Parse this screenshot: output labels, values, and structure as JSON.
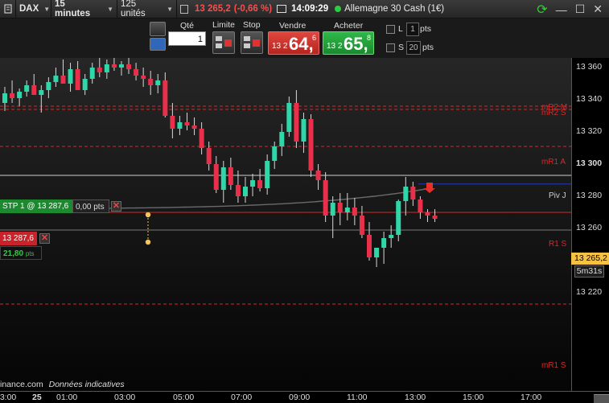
{
  "topbar": {
    "instrument": "DAX",
    "timeframe": "15 minutes",
    "units": "125 unités",
    "last_price": "13 265,2",
    "change": "(-0,66 %)",
    "time": "14:09:29",
    "product": "Allemagne 30 Cash (1€)"
  },
  "orderbar": {
    "qty_label": "Qté",
    "qty_value": "1",
    "limit_label": "Limite",
    "stop_label": "Stop",
    "sell_label": "Vendre",
    "buy_label": "Acheter",
    "sell_price_small": "13 2",
    "sell_price_big": "64,",
    "sell_price_frac": "6",
    "buy_price_small": "13 2",
    "buy_price_big": "65,",
    "buy_price_frac": "8",
    "l_label": "L",
    "l_value": "1",
    "l_unit": "pts",
    "s_label": "S",
    "s_value": "20",
    "s_unit": "pts"
  },
  "chart": {
    "stp_order_label": "STP  1 @ 13 287,6",
    "stp_order_pts": "0,00 pts",
    "position_price": "13 287,6",
    "position_pnl": "21,80",
    "position_pnl_unit": "pts",
    "level_labels": {
      "mR2M": "mR2 M",
      "mR2S": "mR2 S",
      "mR1A": "mR1 A",
      "pivot": "Piv J",
      "R1S": "R1 S",
      "mR1S": "mR1 S"
    },
    "current_price_tag": "13 265,2",
    "countdown": "5m31s",
    "footer_source": "inance.com",
    "footer_note": "Données indicatives",
    "colors": {
      "up": "#2fd6a7",
      "down": "#e8304a",
      "red_level": "#d42a2a",
      "pivot": "#cfcfcf",
      "blue_line": "#1f3bb3"
    }
  },
  "y_axis": [
    "13 360",
    "13 340",
    "13 320",
    "13 300",
    "13 280",
    "13 260",
    "13 240",
    "13 220"
  ],
  "x_axis": [
    "23:00",
    "25",
    "01:00",
    "03:00",
    "05:00",
    "07:00",
    "09:00",
    "11:00",
    "13:00",
    "15:00",
    "17:00"
  ],
  "candles": [
    [
      13338,
      13348,
      13333,
      13344
    ],
    [
      13344,
      13352,
      13338,
      13341
    ],
    [
      13341,
      13347,
      13336,
      13345
    ],
    [
      13345,
      13352,
      13342,
      13349
    ],
    [
      13349,
      13356,
      13345,
      13343
    ],
    [
      13343,
      13349,
      13332,
      13346
    ],
    [
      13346,
      13354,
      13341,
      13351
    ],
    [
      13351,
      13360,
      13348,
      13355
    ],
    [
      13355,
      13365,
      13352,
      13350
    ],
    [
      13350,
      13363,
      13345,
      13359
    ],
    [
      13359,
      13364,
      13348,
      13346
    ],
    [
      13346,
      13356,
      13343,
      13353
    ],
    [
      13353,
      13363,
      13350,
      13360
    ],
    [
      13360,
      13366,
      13354,
      13357
    ],
    [
      13357,
      13365,
      13353,
      13362
    ],
    [
      13362,
      13366,
      13358,
      13360
    ],
    [
      13360,
      13364,
      13355,
      13362
    ],
    [
      13362,
      13366,
      13356,
      13359
    ],
    [
      13359,
      13363,
      13352,
      13355
    ],
    [
      13355,
      13360,
      13348,
      13353
    ],
    [
      13353,
      13358,
      13343,
      13349
    ],
    [
      13349,
      13356,
      13344,
      13352
    ],
    [
      13352,
      13357,
      13329,
      13330
    ],
    [
      13330,
      13338,
      13316,
      13322
    ],
    [
      13322,
      13330,
      13318,
      13326
    ],
    [
      13326,
      13332,
      13321,
      13324
    ],
    [
      13324,
      13329,
      13318,
      13322
    ],
    [
      13322,
      13326,
      13306,
      13310
    ],
    [
      13310,
      13314,
      13296,
      13300
    ],
    [
      13300,
      13305,
      13282,
      13284
    ],
    [
      13284,
      13302,
      13276,
      13298
    ],
    [
      13298,
      13304,
      13284,
      13287
    ],
    [
      13287,
      13296,
      13276,
      13280
    ],
    [
      13280,
      13292,
      13276,
      13286
    ],
    [
      13286,
      13294,
      13280,
      13290
    ],
    [
      13290,
      13297,
      13283,
      13285
    ],
    [
      13285,
      13306,
      13281,
      13302
    ],
    [
      13302,
      13314,
      13297,
      13311
    ],
    [
      13311,
      13325,
      13305,
      13320
    ],
    [
      13320,
      13342,
      13317,
      13338
    ],
    [
      13338,
      13346,
      13310,
      13314
    ],
    [
      13314,
      13332,
      13307,
      13328
    ],
    [
      13328,
      13331,
      13292,
      13296
    ],
    [
      13296,
      13300,
      13284,
      13290
    ],
    [
      13290,
      13295,
      13264,
      13268
    ],
    [
      13268,
      13280,
      13254,
      13276
    ],
    [
      13276,
      13282,
      13262,
      13270
    ],
    [
      13270,
      13282,
      13265,
      13273
    ],
    [
      13273,
      13279,
      13262,
      13268
    ],
    [
      13268,
      13274,
      13254,
      13256
    ],
    [
      13256,
      13264,
      13240,
      13242
    ],
    [
      13242,
      13248,
      13236,
      13248
    ],
    [
      13248,
      13258,
      13238,
      13254
    ],
    [
      13254,
      13262,
      13248,
      13256
    ],
    [
      13256,
      13278,
      13252,
      13277
    ],
    [
      13277,
      13292,
      13268,
      13286
    ],
    [
      13286,
      13289,
      13274,
      13278
    ],
    [
      13278,
      13280,
      13266,
      13270
    ],
    [
      13270,
      13272,
      13264,
      13268
    ],
    [
      13268,
      13272,
      13264,
      13266
    ]
  ],
  "levels": {
    "mR2M": 13336,
    "mR2S": 13334,
    "mR1A": 13311,
    "pivot": 13293,
    "blue": 13287.6,
    "R1S": 13270,
    "mR1S": 13213,
    "lower_gray": 13259
  }
}
